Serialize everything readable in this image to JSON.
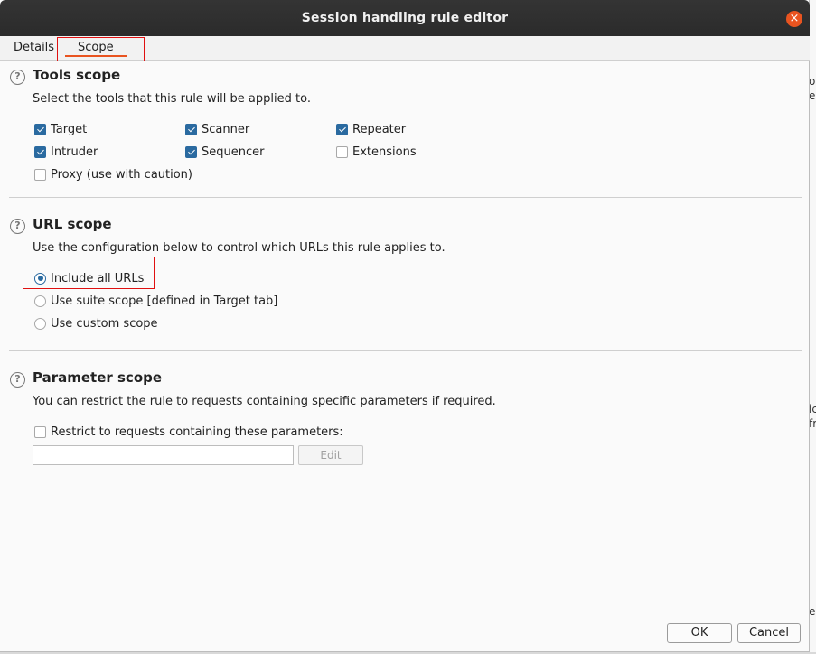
{
  "window": {
    "title": "Session handling rule editor",
    "close_glyph": "×"
  },
  "tabs": [
    {
      "label": "Details"
    },
    {
      "label": "Scope"
    }
  ],
  "help_glyph": "?",
  "tools_scope": {
    "heading": "Tools scope",
    "description": "Select the tools that this rule will be applied to.",
    "tools": [
      {
        "label": "Target",
        "checked": true
      },
      {
        "label": "Scanner",
        "checked": true
      },
      {
        "label": "Repeater",
        "checked": true
      },
      {
        "label": "Intruder",
        "checked": true
      },
      {
        "label": "Sequencer",
        "checked": true
      },
      {
        "label": "Extensions",
        "checked": false
      },
      {
        "label": "Proxy (use with caution)",
        "checked": false
      }
    ]
  },
  "url_scope": {
    "heading": "URL scope",
    "description": "Use the configuration below to control which URLs this rule applies to.",
    "options": [
      {
        "label": "Include all URLs",
        "selected": true
      },
      {
        "label": "Use suite scope [defined in Target tab]",
        "selected": false
      },
      {
        "label": "Use custom scope",
        "selected": false
      }
    ]
  },
  "parameter_scope": {
    "heading": "Parameter scope",
    "description": "You can restrict the rule to requests containing specific parameters if required.",
    "restrict_label": "Restrict to requests containing these parameters:",
    "restrict_checked": false,
    "input_value": "",
    "edit_label": "Edit"
  },
  "buttons": {
    "ok": "OK",
    "cancel": "Cancel"
  },
  "background_fragments": [
    "o",
    "e",
    "ic",
    "fr",
    "e"
  ],
  "colors": {
    "accent": "#e95420",
    "checkbox": "#2a6aa0",
    "highlight_box": "#e01010"
  }
}
